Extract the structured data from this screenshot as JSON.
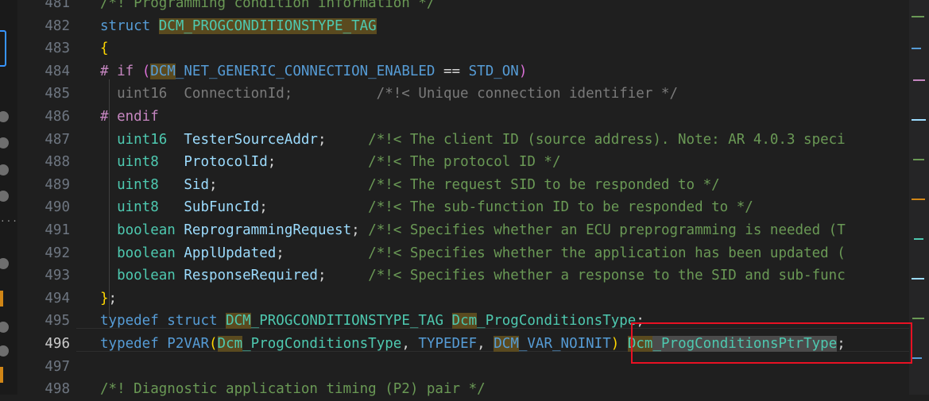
{
  "editor": {
    "line_numbers": [
      "481",
      "482",
      "483",
      "484",
      "485",
      "486",
      "487",
      "488",
      "489",
      "490",
      "491",
      "492",
      "493",
      "494",
      "495",
      "496",
      "497",
      "498"
    ],
    "active_line": "496",
    "lines": [
      {
        "segments": [
          {
            "t": "/*! Programming condition information */",
            "c": "com"
          }
        ]
      },
      {
        "segments": [
          {
            "t": "struct ",
            "c": "kw"
          },
          {
            "t": "DCM_PROGCONDITIONSTYPE_TAG",
            "c": "ty hl"
          }
        ]
      },
      {
        "segments": [
          {
            "t": "{",
            "c": "br"
          }
        ]
      },
      {
        "segments": [
          {
            "t": "# if ",
            "c": "pp"
          },
          {
            "t": "(",
            "c": "br2"
          },
          {
            "t": "DCM",
            "c": "mac hl"
          },
          {
            "t": "_NET_GENERIC_CONNECTION_ENABLED",
            "c": "mac"
          },
          {
            "t": " == ",
            "c": ""
          },
          {
            "t": "STD_ON",
            "c": "mac"
          },
          {
            "t": ")",
            "c": "br2"
          }
        ]
      },
      {
        "segments": [
          {
            "t": "  uint16  ConnectionId;          /*!< Unique connection identifier */",
            "c": "dim"
          }
        ]
      },
      {
        "segments": [
          {
            "t": "# endif",
            "c": "pp"
          }
        ]
      },
      {
        "segments": [
          {
            "t": "  ",
            "c": ""
          },
          {
            "t": "uint16",
            "c": "ty"
          },
          {
            "t": "  ",
            "c": ""
          },
          {
            "t": "TesterSourceAddr",
            "c": "var"
          },
          {
            "t": ";     ",
            "c": ""
          },
          {
            "t": "/*!< The client ID (source address). Note: AR 4.0.3 speci",
            "c": "com"
          }
        ]
      },
      {
        "segments": [
          {
            "t": "  ",
            "c": ""
          },
          {
            "t": "uint8",
            "c": "ty"
          },
          {
            "t": "   ",
            "c": ""
          },
          {
            "t": "ProtocolId",
            "c": "var"
          },
          {
            "t": ";           ",
            "c": ""
          },
          {
            "t": "/*!< The protocol ID */",
            "c": "com"
          }
        ]
      },
      {
        "segments": [
          {
            "t": "  ",
            "c": ""
          },
          {
            "t": "uint8",
            "c": "ty"
          },
          {
            "t": "   ",
            "c": ""
          },
          {
            "t": "Sid",
            "c": "var"
          },
          {
            "t": ";                  ",
            "c": ""
          },
          {
            "t": "/*!< The request SID to be responded to */",
            "c": "com"
          }
        ]
      },
      {
        "segments": [
          {
            "t": "  ",
            "c": ""
          },
          {
            "t": "uint8",
            "c": "ty"
          },
          {
            "t": "   ",
            "c": ""
          },
          {
            "t": "SubFuncId",
            "c": "var"
          },
          {
            "t": ";            ",
            "c": ""
          },
          {
            "t": "/*!< The sub-function ID to be responded to */",
            "c": "com"
          }
        ]
      },
      {
        "segments": [
          {
            "t": "  ",
            "c": ""
          },
          {
            "t": "boolean",
            "c": "ty"
          },
          {
            "t": " ",
            "c": ""
          },
          {
            "t": "ReprogrammingRequest",
            "c": "var"
          },
          {
            "t": "; ",
            "c": ""
          },
          {
            "t": "/*!< Specifies whether an ECU preprogramming is needed (T",
            "c": "com"
          }
        ]
      },
      {
        "segments": [
          {
            "t": "  ",
            "c": ""
          },
          {
            "t": "boolean",
            "c": "ty"
          },
          {
            "t": " ",
            "c": ""
          },
          {
            "t": "ApplUpdated",
            "c": "var"
          },
          {
            "t": ";          ",
            "c": ""
          },
          {
            "t": "/*!< Specifies whether the application has been updated (",
            "c": "com"
          }
        ]
      },
      {
        "segments": [
          {
            "t": "  ",
            "c": ""
          },
          {
            "t": "boolean",
            "c": "ty"
          },
          {
            "t": " ",
            "c": ""
          },
          {
            "t": "ResponseRequired",
            "c": "var"
          },
          {
            "t": ";     ",
            "c": ""
          },
          {
            "t": "/*!< Specifies whether a response to the SID and sub-func",
            "c": "com"
          }
        ]
      },
      {
        "segments": [
          {
            "t": "}",
            "c": "br"
          },
          {
            "t": ";",
            "c": ""
          }
        ]
      },
      {
        "segments": [
          {
            "t": "typedef ",
            "c": "kw"
          },
          {
            "t": "struct ",
            "c": "kw"
          },
          {
            "t": "DCM",
            "c": "ty hl"
          },
          {
            "t": "_PROGCONDITIONSTYPE_TAG",
            "c": "ty"
          },
          {
            "t": " ",
            "c": ""
          },
          {
            "t": "Dcm",
            "c": "ty hl"
          },
          {
            "t": "_ProgConditionsType",
            "c": "ty"
          },
          {
            "t": ";",
            "c": ""
          }
        ]
      },
      {
        "segments": [
          {
            "t": "typedef ",
            "c": "kw"
          },
          {
            "t": "P2VAR",
            "c": "mac"
          },
          {
            "t": "(",
            "c": "br"
          },
          {
            "t": "Dcm",
            "c": "ty hl"
          },
          {
            "t": "_ProgConditionsType",
            "c": "ty"
          },
          {
            "t": ", ",
            "c": ""
          },
          {
            "t": "TYPEDEF",
            "c": "mac"
          },
          {
            "t": ", ",
            "c": ""
          },
          {
            "t": "DCM",
            "c": "mac hl"
          },
          {
            "t": "_VAR_NOINIT",
            "c": "mac"
          },
          {
            "t": ")",
            "c": "br"
          },
          {
            "t": " ",
            "c": ""
          },
          {
            "t": "Dcm",
            "c": "ty hl"
          },
          {
            "t": "_ProgConditionsPtrType",
            "c": "ty hl2"
          },
          {
            "t": ";",
            "c": ""
          }
        ]
      },
      {
        "segments": []
      },
      {
        "segments": [
          {
            "t": "/*! Diagnostic application timing (P2) pair */",
            "c": "com"
          }
        ]
      }
    ]
  },
  "colors": {
    "background": "#1f1f1f",
    "highlight_box": "#e81123",
    "keyword": "#569cd6",
    "type": "#4ec9b0",
    "comment": "#6a9955"
  },
  "left_strip": {
    "items": [
      "selected-frame",
      "circle",
      "circle",
      "circle",
      "circle",
      "circle",
      "dots",
      "orange-marker",
      "circle",
      "circle",
      "circle",
      "circle",
      "orange-marker"
    ]
  }
}
